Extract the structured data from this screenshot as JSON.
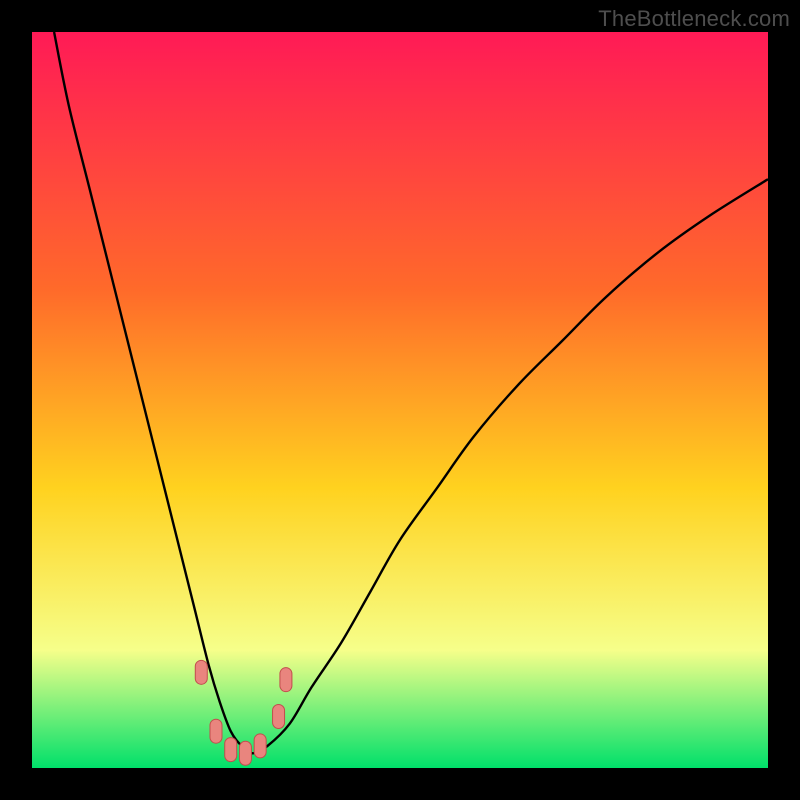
{
  "watermark": "TheBottleneck.com",
  "chart_data": {
    "type": "line",
    "title": "",
    "xlabel": "",
    "ylabel": "",
    "xlim": [
      0,
      100
    ],
    "ylim": [
      0,
      100
    ],
    "grid": false,
    "series": [
      {
        "name": "bottleneck-curve",
        "x": [
          3,
          5,
          8,
          11,
          14,
          17,
          20,
          22,
          24,
          25.5,
          27,
          28.5,
          30,
          32,
          35,
          38,
          42,
          46,
          50,
          55,
          60,
          66,
          72,
          78,
          85,
          92,
          100
        ],
        "y": [
          100,
          90,
          78,
          66,
          54,
          42,
          30,
          22,
          14,
          9,
          5,
          3,
          2,
          3,
          6,
          11,
          17,
          24,
          31,
          38,
          45,
          52,
          58,
          64,
          70,
          75,
          80
        ]
      }
    ],
    "good_band_top_pct": 88,
    "markers": [
      {
        "x": 23,
        "y": 13
      },
      {
        "x": 25,
        "y": 5
      },
      {
        "x": 27,
        "y": 2.5
      },
      {
        "x": 29,
        "y": 2
      },
      {
        "x": 31,
        "y": 3
      },
      {
        "x": 33.5,
        "y": 7
      },
      {
        "x": 34.5,
        "y": 12
      }
    ],
    "colors": {
      "gradient_top": "#ff1a56",
      "gradient_mid1": "#ff6a2a",
      "gradient_mid2": "#ffd21f",
      "gradient_low": "#f6ff8a",
      "gradient_bottom": "#00e06a",
      "curve": "#000000",
      "marker_fill": "#e9857e",
      "marker_stroke": "#c24d4d"
    }
  }
}
